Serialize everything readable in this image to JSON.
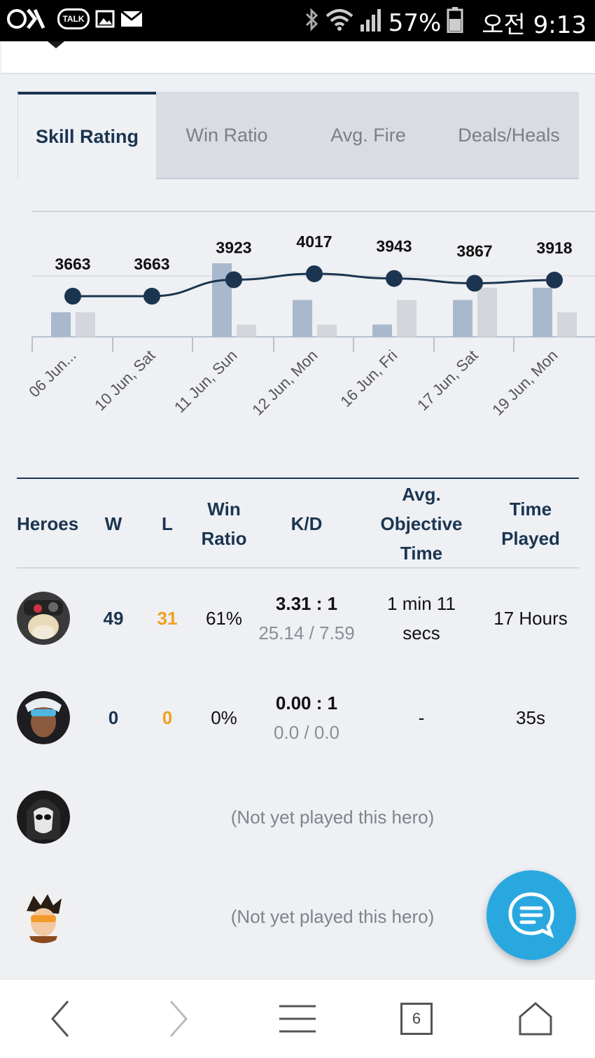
{
  "status_bar": {
    "badge": "TALK",
    "battery": "57%",
    "time": "오전 9:13"
  },
  "tabs": [
    {
      "label": "Skill Rating",
      "active": true
    },
    {
      "label": "Win Ratio",
      "active": false
    },
    {
      "label": "Avg. Fire",
      "active": false
    },
    {
      "label": "Deals/Heals",
      "active": false
    }
  ],
  "chart_data": {
    "type": "line",
    "categories": [
      "06 Jun...",
      "10 Jun, Sat",
      "11 Jun, Sun",
      "12 Jun, Mon",
      "16 Jun, Fri",
      "17 Jun, Sat",
      "19 Jun, Mon"
    ],
    "series": [
      {
        "values": [
          3663,
          3663,
          3923,
          4017,
          3943,
          3867,
          3918
        ]
      },
      {
        "values": [
          2,
          0,
          6,
          3,
          1,
          3,
          4
        ]
      },
      {
        "values": [
          2,
          0,
          1,
          1,
          3,
          4,
          2
        ]
      }
    ],
    "colors": {
      "line": "#1b3550",
      "bar_a": "#a9b8cc",
      "bar_b": "#d3d6db"
    }
  },
  "table": {
    "headers": {
      "heroes": "Heroes",
      "w": "W",
      "l": "L",
      "win_ratio": [
        "Win",
        "Ratio"
      ],
      "kd": "K/D",
      "obj_time": [
        "Avg.",
        "Objective",
        "Time"
      ],
      "time_played": [
        "Time",
        "Played"
      ]
    },
    "rows": [
      {
        "hero": "torbjorn",
        "played": true,
        "w": "49",
        "l": "31",
        "win_ratio": "61%",
        "kd": "3.31 : 1",
        "kd_detail": "25.14 / 7.59",
        "obj_time": [
          "1 min 11",
          "secs"
        ],
        "time_played": "17 Hours"
      },
      {
        "hero": "symmetra",
        "played": true,
        "w": "0",
        "l": "0",
        "win_ratio": "0%",
        "kd": "0.00 : 1",
        "kd_detail": "0.0 / 0.0",
        "obj_time": [
          "-"
        ],
        "time_played": "35s"
      },
      {
        "hero": "reaper",
        "played": false,
        "message": "(Not yet played this hero)"
      },
      {
        "hero": "tracer",
        "played": false,
        "message": "(Not yet played this hero)"
      }
    ]
  },
  "bottom_nav": {
    "tab_count": "6"
  }
}
